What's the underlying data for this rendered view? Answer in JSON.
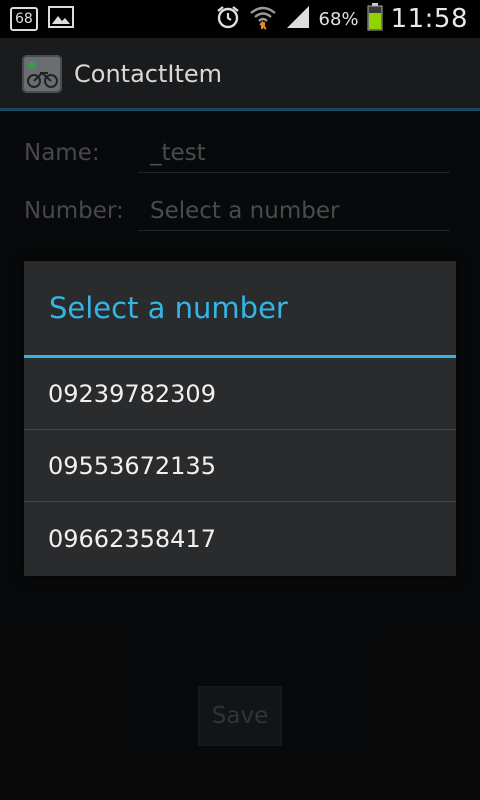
{
  "status_bar": {
    "badge": "68",
    "battery_percent": "68%",
    "time": "11:58",
    "icons": [
      "sim-badge-icon",
      "image-icon",
      "alarm-icon",
      "wifi-icon",
      "signal-icon",
      "battery-icon"
    ],
    "battery_color": "#8fd400"
  },
  "action_bar": {
    "title": "ContactItem",
    "app_icon": "contact-app-icon",
    "accent_color": "#2a7fa4"
  },
  "form": {
    "name_label": "Name:",
    "name_value": "_test",
    "number_label": "Number:",
    "number_placeholder": "Select a number",
    "save_label": "Save"
  },
  "dialog": {
    "title": "Select a number",
    "title_color": "#33b5e5",
    "items": [
      "09239782309",
      "09553672135",
      "09662358417"
    ]
  }
}
